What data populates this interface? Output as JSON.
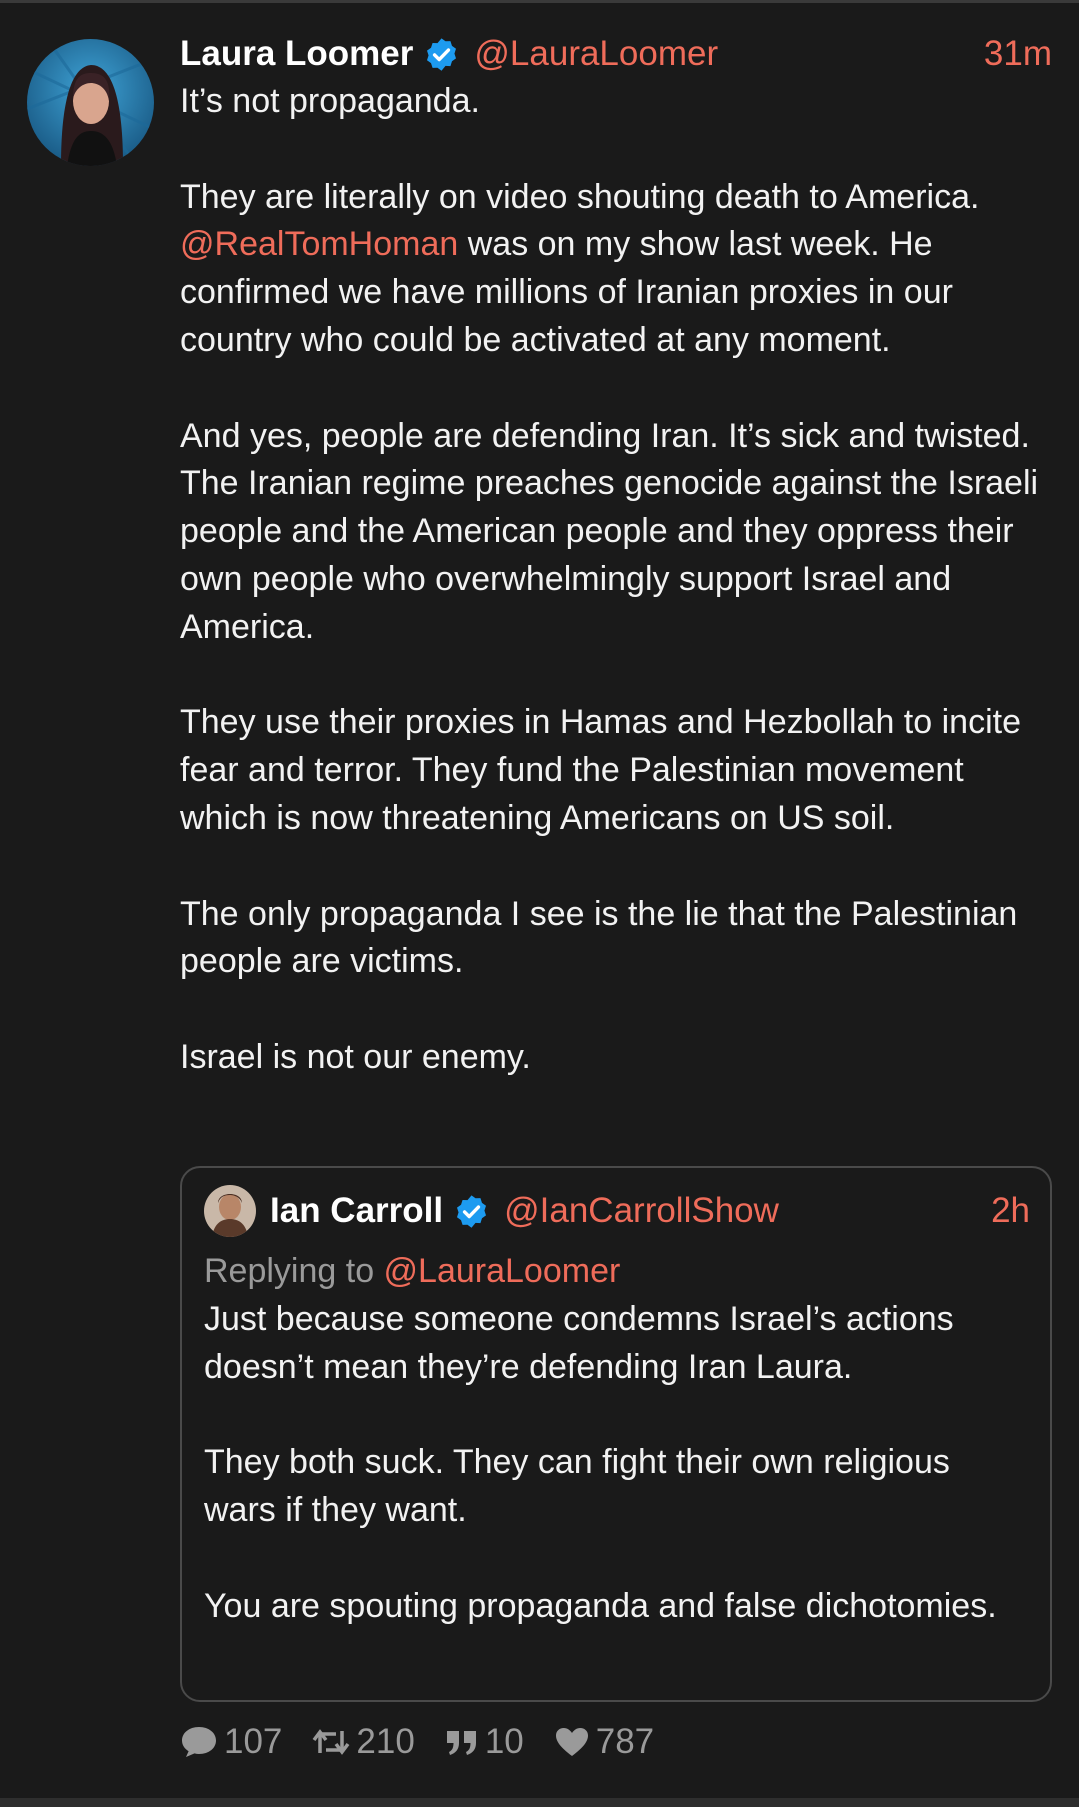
{
  "tweet": {
    "author_name": "Laura Loomer",
    "author_handle": "@LauraLoomer",
    "time": "31m",
    "paragraphs": {
      "p1": "It’s not propaganda.",
      "p2_line1": "They are literally on video shouting death to America.",
      "p2_mention": "@RealTomHoman",
      "p2_rest": " was on my show last week. He confirmed we have millions of Iranian proxies in our country who could be activated at any moment.",
      "p3": "And yes, people are defending Iran. It’s sick and twisted. The Iranian regime preaches genocide against the Israeli people and the American people and they oppress their own people who overwhelmingly support Israel and America.",
      "p4": "They use their proxies in Hamas and Hezbollah to incite fear and terror. They fund the Palestinian movement which is now threatening Americans on US soil.",
      "p5": "The only propaganda I see is the lie that the Palestinian people are victims.",
      "p6": "Israel is not our enemy."
    }
  },
  "quote": {
    "author_name": "Ian Carroll",
    "author_handle": "@IanCarrollShow",
    "time": "2h",
    "replying_prefix": "Replying to ",
    "replying_handle": "@LauraLoomer",
    "paragraphs": {
      "p1": "Just because someone condemns Israel’s actions doesn’t mean they’re defending Iran Laura.",
      "p2": "They both suck. They can fight their own religious wars if they want.",
      "p3": "You are spouting propaganda and false dichotomies."
    }
  },
  "actions": {
    "replies": "107",
    "reposts": "210",
    "quotes": "10",
    "likes": "787"
  },
  "colors": {
    "background": "#1a1a1a",
    "accent": "#ef6c5a",
    "verified": "#1d9bf0",
    "muted": "#9a9a9a"
  }
}
